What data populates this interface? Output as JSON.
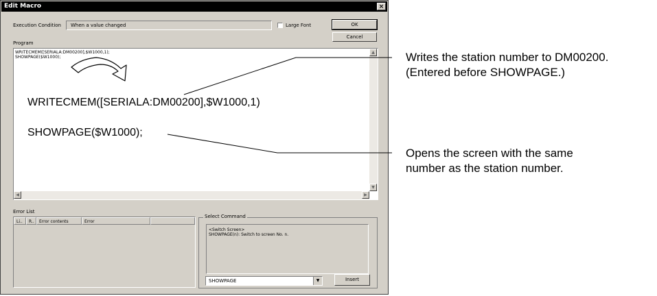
{
  "window": {
    "title": "Edit Macro",
    "close_glyph": "×"
  },
  "execution": {
    "label": "Execution Condition",
    "value": "When a value changed"
  },
  "large_font": {
    "label": "Large Font",
    "checked": false
  },
  "buttons": {
    "ok": "OK",
    "cancel": "Cancel",
    "insert": "Insert"
  },
  "program": {
    "label": "Program",
    "lines": [
      "WRITECMEM([SERIALA:DM00200],$W1000,1);",
      "SHOWPAGE($W1000);"
    ],
    "zoom_line1": "WRITECMEM([SERIALA:DM00200],$W1000,1)",
    "zoom_line2": "SHOWPAGE($W1000);"
  },
  "error_list": {
    "label": "Error List",
    "columns": [
      "Li..",
      "R..",
      "Error contents",
      "Error"
    ]
  },
  "select_command": {
    "label": "Select Command",
    "description_line1": "<Switch Screen>",
    "description_line2": "SHOWPAGE(n): Switch to screen No. n.",
    "selected": "SHOWPAGE"
  },
  "annotations": {
    "a1_line1": "Writes the station number to DM00200.",
    "a1_line2": "(Entered before SHOWPAGE.)",
    "a2_line1": "Opens the screen with the same",
    "a2_line2": "number as the station number."
  }
}
